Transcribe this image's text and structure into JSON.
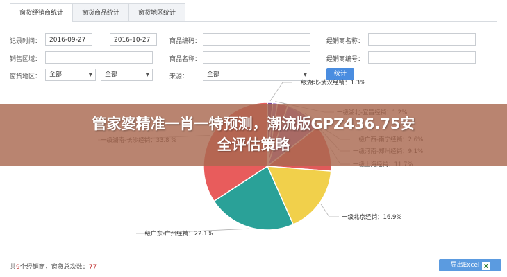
{
  "tabs": [
    {
      "label": "窗货经销商统计"
    },
    {
      "label": "窗货商品统计"
    },
    {
      "label": "窗货地区统计"
    }
  ],
  "form": {
    "record_time_label": "记录时间：",
    "date_from": "2016-09-27",
    "date_to": "2016-10-27",
    "product_code_label": "商品编码：",
    "dealer_name_label": "经销商名称：",
    "sales_area_label": "销售区域：",
    "product_name_label": "商品名称：",
    "dealer_code_label": "经销商编号：",
    "region_label": "窗货地区：",
    "region_select_1": "全部",
    "region_select_2": "全部",
    "source_label": "来源：",
    "source_select": "全部",
    "stat_button": "统计"
  },
  "chart_data": {
    "type": "pie",
    "slices": [
      {
        "label": "一级湖北-武汉经销",
        "value": 1.3,
        "color": "#7d4fa0"
      },
      {
        "label": "一级湖北-宜昌经销",
        "value": 1.2,
        "color": "#9b6fbf"
      },
      {
        "label": "一级广西-南宁经销",
        "value": 2.6,
        "color": "#b05a8c"
      },
      {
        "label": "一级河南-郑州经销",
        "value": 9.1,
        "color": "#a070c0"
      },
      {
        "label": "一级上海经销",
        "value": 11.7,
        "color": "#e05a5a"
      },
      {
        "label": "一级北京经销",
        "value": 16.9,
        "color": "#f1d04b"
      },
      {
        "label": "一级广东-广州经销",
        "value": 22.1,
        "color": "#2aa198"
      },
      {
        "label": "一级湖南-长沙经销",
        "value": 33.8,
        "color": "#e85c5c"
      }
    ],
    "label_texts": [
      "一级湖北-武汉经销：1.3%",
      "一级湖北-宜昌经销：1.2%",
      "一级广西-南宁经销：2.6%",
      "一级河南-郑州经销：9.1%",
      "一级上海经销：11.7%",
      "一级北京经销：16.9%",
      "一级广东-广州经销：22.1%",
      "一级湖南-长沙经销：33.8 %"
    ]
  },
  "banner": {
    "line1": "管家婆精准一肖一特预测，潮流版GPZ436.75安",
    "line2": "全评估策略"
  },
  "footer": {
    "prefix": "共",
    "dealer_count": "9",
    "middle": "个经销商，窗货总次数：",
    "total_count": "77"
  },
  "export_button": "导出Excel",
  "export_icon": "X"
}
